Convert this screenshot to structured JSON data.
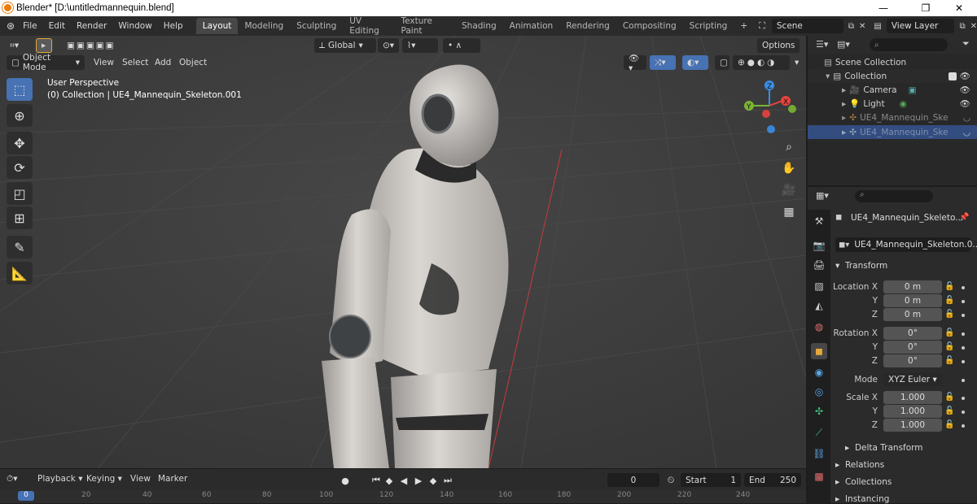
{
  "window": {
    "title": "Blender* [D:\\untitledmannequin.blend]",
    "minimize": "—",
    "maximize": "❐",
    "close": "✕"
  },
  "menubar": [
    "File",
    "Edit",
    "Render",
    "Window",
    "Help"
  ],
  "workspaces": [
    "Layout",
    "Modeling",
    "Sculpting",
    "UV Editing",
    "Texture Paint",
    "Shading",
    "Animation",
    "Rendering",
    "Compositing",
    "Scripting"
  ],
  "add_workspace": "+",
  "scene": {
    "name": "Scene"
  },
  "view_layer": {
    "name": "View Layer"
  },
  "viewport": {
    "mode": "Object Mode",
    "menus": [
      "View",
      "Select",
      "Add",
      "Object"
    ],
    "transform_orientation": "Global",
    "options_label": "Options",
    "overlay_title": "User Perspective",
    "overlay_subtitle": "(0) Collection | UE4_Mannequin_Skeleton.001",
    "gizmo": {
      "x": "X",
      "y": "Y",
      "z": "Z"
    }
  },
  "timeline": {
    "menus": [
      "Playback",
      "Keying",
      "View",
      "Marker"
    ],
    "current_frame": "0",
    "start_label": "Start",
    "start": "1",
    "end_label": "End",
    "end": "250",
    "ticks": [
      "0",
      "20",
      "40",
      "60",
      "80",
      "100",
      "120",
      "140",
      "160",
      "180",
      "200",
      "220",
      "240"
    ]
  },
  "outliner": {
    "search_placeholder": "",
    "root": "Scene Collection",
    "items": [
      {
        "label": "Collection"
      },
      {
        "label": "Camera"
      },
      {
        "label": "Light"
      },
      {
        "label": "UE4_Mannequin_Ske"
      },
      {
        "label": "UE4_Mannequin_Ske"
      }
    ]
  },
  "properties": {
    "object_name": "UE4_Mannequin_Skeleto...",
    "data_name": "UE4_Mannequin_Skeleton.0...",
    "transform_header": "Transform",
    "location_label": "Location X",
    "rotation_label": "Rotation X",
    "scale_label": "Scale X",
    "y_label": "Y",
    "z_label": "Z",
    "mode_label": "Mode",
    "mode_value": "XYZ Euler",
    "location": [
      "0 m",
      "0 m",
      "0 m"
    ],
    "rotation": [
      "0°",
      "0°",
      "0°"
    ],
    "scale": [
      "1.000",
      "1.000",
      "1.000"
    ],
    "sections": [
      "Delta Transform",
      "Relations",
      "Collections",
      "Instancing"
    ]
  },
  "colors": {
    "accent": "#4772b3",
    "active_tab": "#474747",
    "x_axis": "#e8423f",
    "y_axis": "#7ab532",
    "z_axis": "#3a8ee6"
  }
}
